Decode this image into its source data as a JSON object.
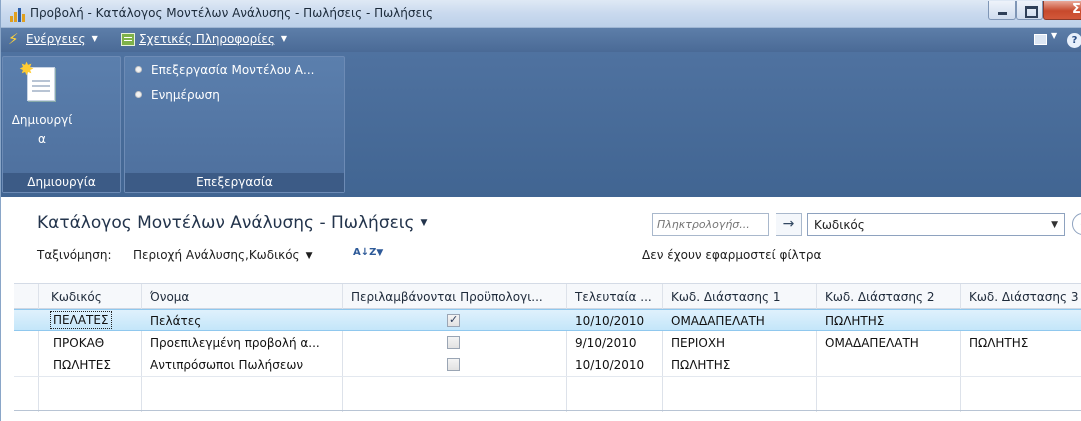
{
  "window": {
    "title": "Προβολή - Κατάλογος Μοντέλων Ανάλυσης - Πωλήσεις - Πωλήσεις",
    "close_glyph": "Σ"
  },
  "menubar": {
    "actions_label": "Ενέργειες",
    "info_label": "Σχετικές Πληροφορίες",
    "help_glyph": "?"
  },
  "ribbon": {
    "groups": [
      {
        "label": "Δημιουργία",
        "buttons": [
          {
            "label_line1": "Δημιουργί",
            "label_line2": "α",
            "icon": "new-document-icon"
          }
        ]
      },
      {
        "label": "Επεξεργασία",
        "buttons": [
          {
            "label": "Επεξεργασία Μοντέλου Α...",
            "icon": "bullet-icon"
          },
          {
            "label": "Ενημέρωση",
            "icon": "bullet-icon"
          }
        ]
      }
    ]
  },
  "page": {
    "title": "Κατάλογος Μοντέλων Ανάλυσης - Πωλήσεις",
    "search_placeholder": "Πληκτρολογήσ...",
    "search_go_glyph": "→",
    "filter_field": "Κωδικός",
    "sort_label": "Ταξινόμηση:",
    "sort_value": "Περιοχή Ανάλυσης,Κωδικός",
    "sort_icon_glyph": "A↓Z",
    "filter_note": "Δεν έχουν εφαρμοστεί φίλτρα"
  },
  "grid": {
    "columns": [
      "Κωδικός",
      "Όνομα",
      "Περιλαμβάνονται Προϋπολογι...",
      "Τελευταία ...",
      "Κωδ. Διάστασης 1",
      "Κωδ. Διάστασης 2",
      "Κωδ. Διάστασης 3"
    ],
    "rows": [
      {
        "code": "ΠΕΛΑΤΕΣ",
        "name": "Πελάτες",
        "include_budgets": true,
        "last_date": "10/10/2010",
        "dim1": "ΟΜΑΔΑΠΕΛΑΤΗ",
        "dim2": "ΠΩΛΗΤΗΣ",
        "dim3": ""
      },
      {
        "code": "ΠΡΟΚΑΘ",
        "name": "Προεπιλεγμένη προβολή α...",
        "include_budgets": false,
        "last_date": "9/10/2010",
        "dim1": "ΠΕΡΙΟΧΗ",
        "dim2": "ΟΜΑΔΑΠΕΛΑΤΗ",
        "dim3": "ΠΩΛΗΤΗΣ"
      },
      {
        "code": "ΠΩΛΗΤΕΣ",
        "name": "Αντιπρόσωποι Πωλήσεων",
        "include_budgets": false,
        "last_date": "10/10/2010",
        "dim1": "ΠΩΛΗΤΗΣ",
        "dim2": "",
        "dim3": ""
      }
    ]
  },
  "colors": {
    "menubar": "#4a6a96",
    "ribbon": "#416592",
    "selected_row": "#c4e6fa"
  }
}
